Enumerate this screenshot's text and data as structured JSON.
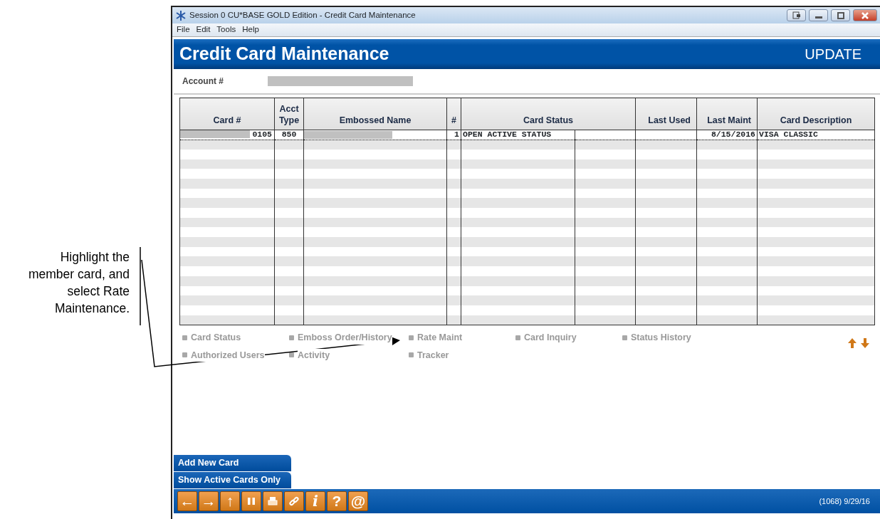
{
  "callout": {
    "text": "Highlight the member card, and select Rate Maintenance."
  },
  "window": {
    "title": "Session 0 CU*BASE GOLD Edition - Credit Card Maintenance"
  },
  "menu": [
    "File",
    "Edit",
    "Tools",
    "Help"
  ],
  "header": {
    "title": "Credit Card Maintenance",
    "mode": "UPDATE"
  },
  "account": {
    "label": "Account #"
  },
  "table": {
    "columns": [
      "Card #",
      "Acct Type",
      "Embossed Name",
      "#",
      "Card Status",
      "Last Used",
      "Last Maint",
      "Card Description"
    ],
    "rows": [
      {
        "selected": true,
        "card": "0105",
        "acct_type": "850",
        "number": "1",
        "card_status": "OPEN ACTIVE STATUS",
        "last_maint": "8/15/2016",
        "card_description": "VISA CLASSIC"
      }
    ]
  },
  "actions": [
    [
      "Card Status",
      "Emboss Order/History",
      "Rate Maint",
      "Card Inquiry",
      "Status History"
    ],
    [
      "Authorized Users",
      "Activity",
      "Tracker"
    ]
  ],
  "side_buttons": [
    "Add New Card",
    "Show Active Cards Only"
  ],
  "toolbar": [
    {
      "kind": "glyph",
      "text": "←"
    },
    {
      "kind": "glyph",
      "text": "→"
    },
    {
      "kind": "glyph",
      "text": "↑"
    },
    {
      "kind": "pause"
    },
    {
      "kind": "print"
    },
    {
      "kind": "link"
    },
    {
      "kind": "italic",
      "text": "i"
    },
    {
      "kind": "glyph",
      "text": "?"
    },
    {
      "kind": "glyph",
      "text": "@"
    }
  ],
  "status": "(1068) 9/29/16"
}
